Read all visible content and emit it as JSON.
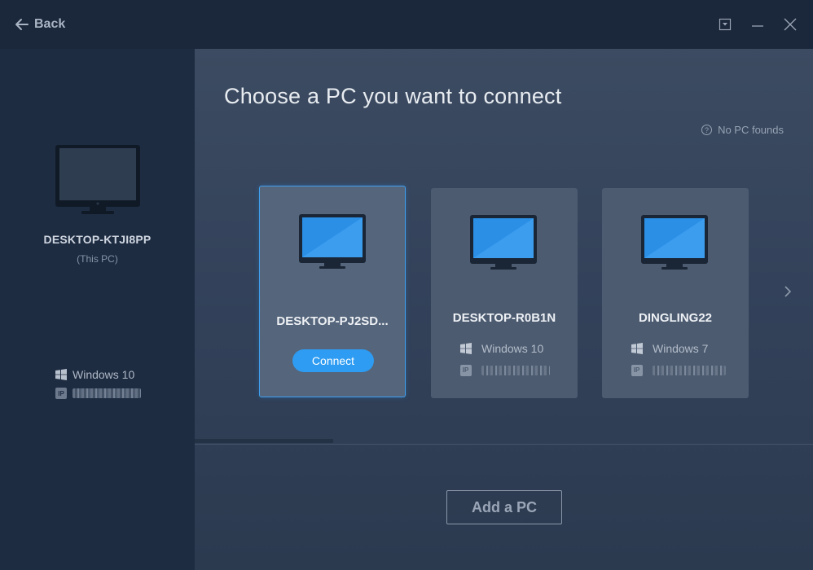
{
  "titlebar": {
    "back_label": "Back",
    "icons": [
      "back-arrow-icon",
      "dropdown-icon",
      "minimize-icon",
      "close-icon"
    ]
  },
  "this_pc": {
    "name": "DESKTOP-KTJI8PP",
    "subtitle": "(This PC)",
    "os": "Windows 10",
    "ip_label": "IP"
  },
  "main": {
    "title": "Choose a PC you want to connect",
    "no_pc_link": "No PC founds",
    "help_glyph": "?"
  },
  "cards": [
    {
      "name": "DESKTOP-PJ2SD...",
      "selected": true,
      "button": "Connect"
    },
    {
      "name": "DESKTOP-R0B1N",
      "os": "Windows 10",
      "ip_label": "IP"
    },
    {
      "name": "DINGLING22",
      "os": "Windows 7",
      "ip_label": "IP"
    }
  ],
  "footer": {
    "add_pc_label": "Add a PC"
  },
  "colors": {
    "accent": "#2d9cf2",
    "sidebar_bg": "#1e2c42",
    "titlebar_bg": "#1b273a",
    "card_bg": "#4c5b70",
    "selected_border": "#3fa0f0"
  }
}
